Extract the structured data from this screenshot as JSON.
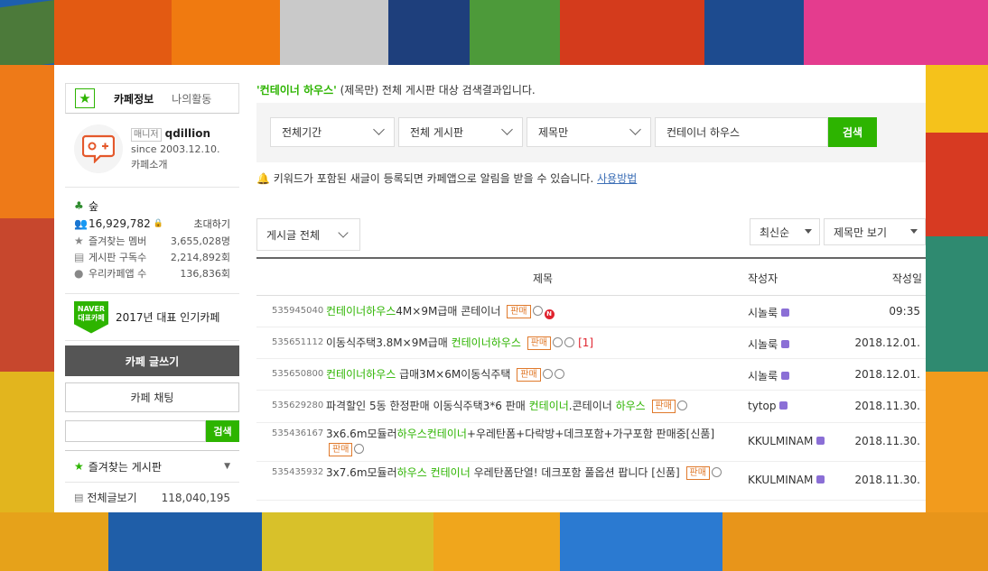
{
  "sidebar": {
    "tabs": [
      "카페정보",
      "나의활동"
    ],
    "manager_badge": "매니저",
    "manager_name": "qdillion",
    "since": "since 2003.12.10.",
    "cafe_intro": "카페소개",
    "level": "숲",
    "members": "16,929,782",
    "invite": "초대하기",
    "stats": [
      {
        "label": "즐겨찾는 멤버",
        "value": "3,655,028명"
      },
      {
        "label": "게시판 구독수",
        "value": "2,214,892회"
      },
      {
        "label": "우리카페앱 수",
        "value": "136,836회"
      }
    ],
    "naver_badge_top": "NAVER",
    "naver_badge_bottom": "대표카페",
    "naver_label": "2017년 대표 인기카페",
    "write_button": "카페 글쓰기",
    "chat_button": "카페 채팅",
    "search_button": "검색",
    "favorites_title": "즐겨찾는 게시판",
    "all_posts_label": "전체글보기",
    "all_posts_count": "118,040,195"
  },
  "content": {
    "result_keyword": "'컨테이너 하우스'",
    "result_text": " (제목만) 전체 게시판 대상 검색결과입니다.",
    "search": {
      "period": "전체기간",
      "board": "전체 게시판",
      "scope": "제목만",
      "query": "컨테이너 하우스",
      "button": "검색"
    },
    "alert_text": "키워드가 포함된 새글이 등록되면 카페앱으로 알림을 받을 수 있습니다.",
    "alert_link": "사용방법",
    "filter_all": "게시글 전체",
    "sort": "최신순",
    "view_mode": "제목만 보기",
    "columns": {
      "title": "제목",
      "author": "작성자",
      "date": "작성일"
    },
    "sale_tag": "판매",
    "rows": [
      {
        "num": "535945040",
        "author": "시놀룩",
        "date": "09:35"
      },
      {
        "num": "535651112",
        "author": "시놀룩",
        "date": "2018.12.01.",
        "comments": "[1]"
      },
      {
        "num": "535650800",
        "author": "시놀룩",
        "date": "2018.12.01."
      },
      {
        "num": "535629280",
        "author": "tytop",
        "date": "2018.11.30."
      },
      {
        "num": "535436167",
        "author": "KKULMINAM",
        "date": "2018.11.30."
      },
      {
        "num": "535435932",
        "author": "KKULMINAM",
        "date": "2018.11.30."
      }
    ],
    "titles": {
      "r0": {
        "a": "컨테이너하우스",
        "b": "4M×9M급매 콘테이너"
      },
      "r1": {
        "a": "이동식주택3.8M×9M급매 ",
        "b": "컨테이너하우스"
      },
      "r2": {
        "a": "컨테이너하우스",
        "b": " 급매3M×6M이동식주택"
      },
      "r3": {
        "a": "파격할인 5동 한정판매 이동식주택3*6 판매 ",
        "b": "컨테이너",
        "c": ".콘테이너 ",
        "d": "하우스"
      },
      "r4": {
        "a": "3x6.6m모듈러",
        "b": "하우스컨테이너",
        "c": "+우레탄폼+다락방+데크포함+가구포함 판매중[신품]"
      },
      "r5": {
        "a": "3x7.6m모듈러",
        "b": "하우스 컨테이너",
        "c": " 우레탄폼단열! 데크포함 풀옵션 팝니다 [신품]"
      }
    }
  }
}
